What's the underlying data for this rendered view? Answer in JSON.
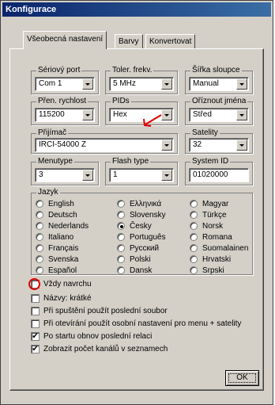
{
  "window": {
    "title": "Konfigurace"
  },
  "tabs": [
    {
      "label": "Všeobecná nastavení",
      "active": true
    },
    {
      "label": "Barvy",
      "active": false
    },
    {
      "label": "Konvertovat",
      "active": false
    }
  ],
  "settings": {
    "serial_port": {
      "label": "Sériový port",
      "value": "Com 1"
    },
    "tolerance": {
      "label": "Toler. frekv.",
      "value": "5 MHz"
    },
    "column_width": {
      "label": "Šířka sloupce",
      "value": "Manual"
    },
    "baud_rate": {
      "label": "Přen. rychlost",
      "value": "115200"
    },
    "pids": {
      "label": "PIDs",
      "value": "Hex"
    },
    "trim_names": {
      "label": "Oříznout jména",
      "value": "Střed"
    },
    "receiver": {
      "label": "Přijímač",
      "value": "IRCI-54000 Z"
    },
    "satellites": {
      "label": "Satelity",
      "value": "32"
    },
    "menutype": {
      "label": "Menutype",
      "value": "3"
    },
    "flash_type": {
      "label": "Flash type",
      "value": "1"
    },
    "system_id": {
      "label": "System ID",
      "value": "01020000"
    }
  },
  "language": {
    "label": "Jazyk",
    "options": [
      {
        "label": "English",
        "selected": false
      },
      {
        "label": "Deutsch",
        "selected": false
      },
      {
        "label": "Nederlands",
        "selected": false
      },
      {
        "label": "Italiano",
        "selected": false
      },
      {
        "label": "Français",
        "selected": false
      },
      {
        "label": "Svenska",
        "selected": false
      },
      {
        "label": "Español",
        "selected": false
      },
      {
        "label": "Ελληνικά",
        "selected": false
      },
      {
        "label": "Slovensky",
        "selected": false
      },
      {
        "label": "Česky",
        "selected": true
      },
      {
        "label": "Português",
        "selected": false
      },
      {
        "label": "Русский",
        "selected": false
      },
      {
        "label": "Polski",
        "selected": false
      },
      {
        "label": "Dansk",
        "selected": false
      },
      {
        "label": "Magyar",
        "selected": false
      },
      {
        "label": "Türkçe",
        "selected": false
      },
      {
        "label": "Norsk",
        "selected": false
      },
      {
        "label": "Romana",
        "selected": false
      },
      {
        "label": "Suomalainen",
        "selected": false
      },
      {
        "label": "Hrvatski",
        "selected": false
      },
      {
        "label": "Srpski",
        "selected": false
      }
    ]
  },
  "checkboxes": [
    {
      "label": "Vždy navrchu",
      "checked": false
    },
    {
      "label": "Názvy: krátké",
      "checked": false
    },
    {
      "label": "Při spuštění použít poslední soubor",
      "checked": false
    },
    {
      "label": "Při otevírání použít osobní nastavení pro menu + satelity",
      "checked": false
    },
    {
      "label": "Po startu obnov poslední relaci",
      "checked": true
    },
    {
      "label": "Zobrazit počet kanálů v seznamech",
      "checked": true
    }
  ],
  "buttons": {
    "ok": "OK"
  },
  "annotation_color": "#e00000"
}
